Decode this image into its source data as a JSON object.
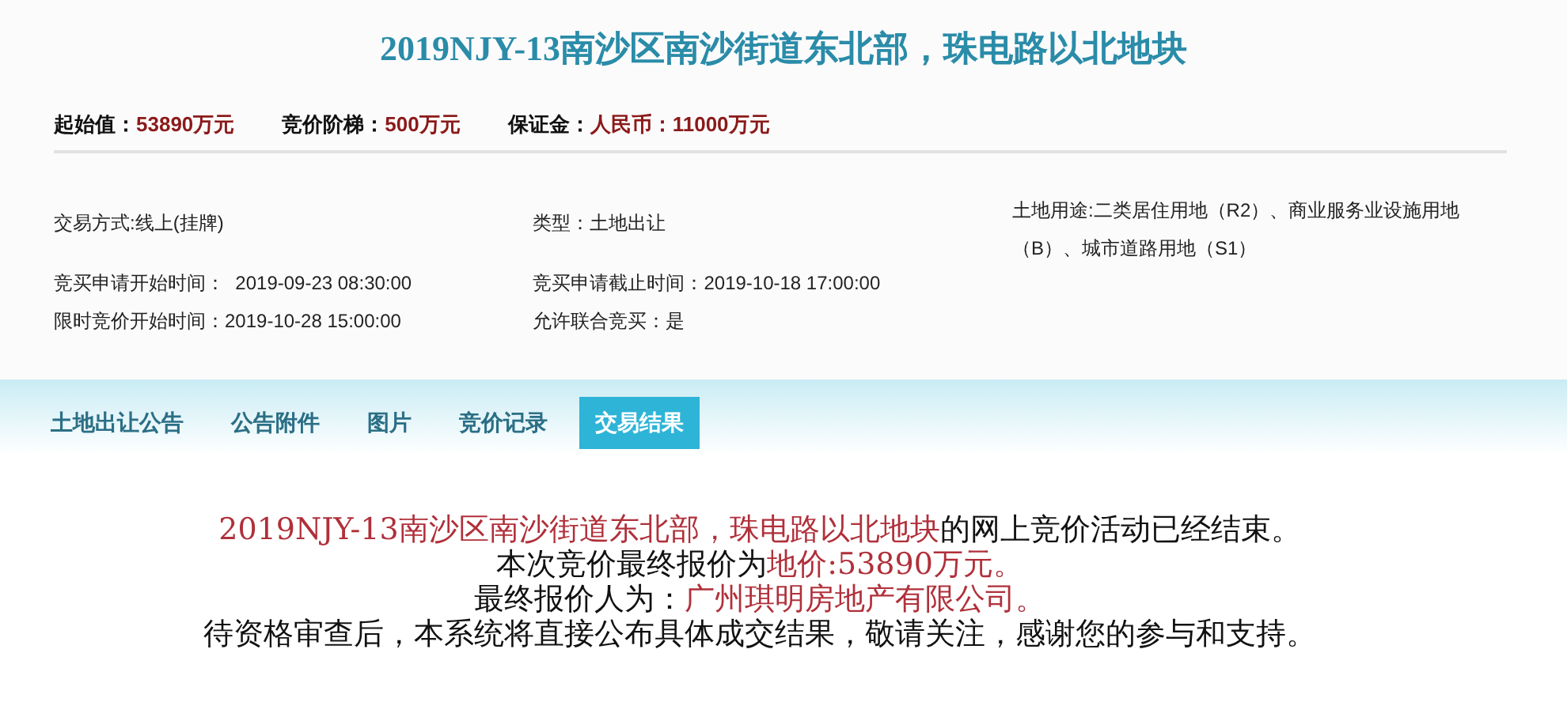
{
  "title": "2019NJY-13南沙区南沙街道东北部，珠电路以北地块",
  "summary": [
    {
      "label": "起始值：",
      "value": "53890万元"
    },
    {
      "label": "竞价阶梯：",
      "value": "500万元"
    },
    {
      "label": "保证金：",
      "value": "人民币：11000万元"
    }
  ],
  "details_left": [
    {
      "text": "交易方式:线上(挂牌)"
    },
    {
      "text": "竞买申请开始时间：  2019-09-23 08:30:00"
    },
    {
      "text": "限时竞价开始时间：2019-10-28 15:00:00"
    }
  ],
  "details_middle": [
    {
      "text": "类型：土地出让"
    },
    {
      "text": "竞买申请截止时间：2019-10-18 17:00:00"
    },
    {
      "text": "允许联合竞买：是"
    }
  ],
  "land_use": "土地用途:二类居住用地（R2）、商业服务业设施用地（B）、城市道路用地（S1）",
  "tabs": [
    {
      "label": "土地出让公告",
      "selected": false
    },
    {
      "label": "公告附件",
      "selected": false
    },
    {
      "label": "图片",
      "selected": false
    },
    {
      "label": "竞价记录",
      "selected": false
    },
    {
      "label": "交易结果",
      "selected": true
    }
  ],
  "result_lines": [
    [
      {
        "text": "2019NJY-13南沙区南沙街道东北部，珠电路以北地块",
        "highlight": true
      },
      {
        "text": "的网上竞价活动已经结束。",
        "highlight": false
      }
    ],
    [
      {
        "text": "本次竞价最终报价为",
        "highlight": false
      },
      {
        "text": "地价:53890万元。",
        "highlight": true
      }
    ],
    [
      {
        "text": "最终报价人为：",
        "highlight": false
      },
      {
        "text": "广州琪明房地产有限公司。",
        "highlight": true
      }
    ],
    [
      {
        "text": "待资格审查后，本系统将直接公布具体成交结果，敬请关注，感谢您的参与和支持。",
        "highlight": false
      }
    ]
  ]
}
